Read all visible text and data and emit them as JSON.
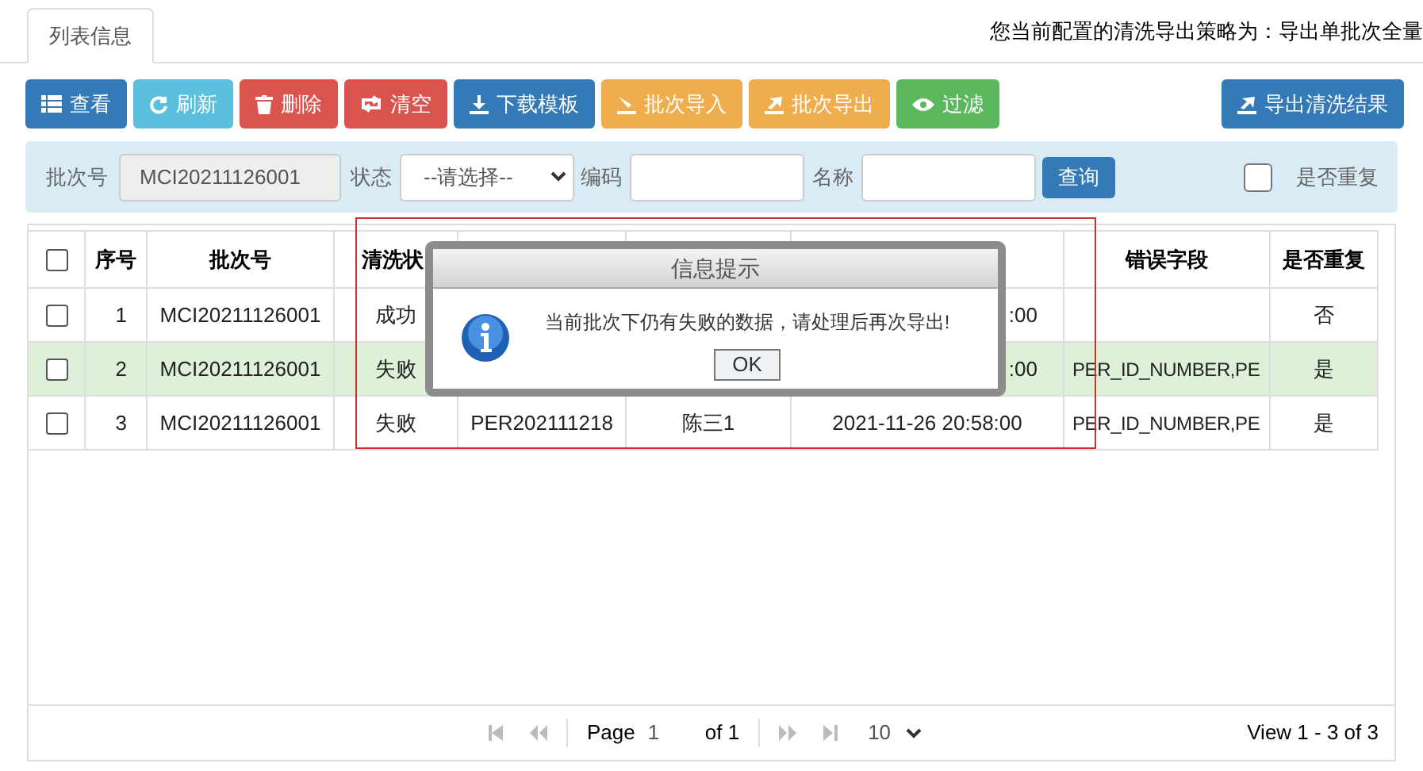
{
  "tabs": [
    {
      "label": "列表信息",
      "selected": true
    }
  ],
  "policy_text": "您当前配置的清洗导出策略为：导出单批次全量",
  "toolbar": [
    {
      "label": "查看",
      "color": "#337ab7"
    },
    {
      "label": "刷新",
      "color": "#5bc0de"
    },
    {
      "label": "删除",
      "color": "#d9534f"
    },
    {
      "label": "清空",
      "color": "#d9534f"
    },
    {
      "label": "下载模板",
      "color": "#337ab7"
    },
    {
      "label": "批次导入",
      "color": "#f0ad4e"
    },
    {
      "label": "批次导出",
      "color": "#f0ad4e"
    },
    {
      "label": "过滤",
      "color": "#5cb85c"
    }
  ],
  "export_button": {
    "label": "导出清洗结果"
  },
  "search": {
    "batch_label": "批次号",
    "batch_value": "MCI20211126001",
    "status_label": "状态",
    "status_placeholder": "--请选择--",
    "code_label": "编码",
    "name_label": "名称",
    "query_button": "查询",
    "duplicate_label": "是否重复",
    "duplicate_checked": false
  },
  "table": {
    "all_checked": false,
    "columns": [
      {
        "label": "序号"
      },
      {
        "label": "批次号"
      },
      {
        "label": "清洗状"
      },
      {},
      {},
      {},
      {
        "label": "错误字段"
      },
      {
        "label": "是否重复"
      }
    ],
    "rows": [
      {
        "checked": false,
        "selected": false,
        "cells": [
          "1",
          "MCI20211126001",
          "成功",
          null,
          null,
          ":00",
          null,
          "否"
        ]
      },
      {
        "checked": false,
        "selected": true,
        "cells": [
          "2",
          "MCI20211126001",
          "失败",
          null,
          null,
          ":00",
          "PER_ID_NUMBER,PE",
          "是"
        ]
      },
      {
        "checked": false,
        "selected": false,
        "cells": [
          "3",
          "MCI20211126001",
          "失败",
          "PER202111218",
          "陈三1",
          "2021-11-26 20:58:00",
          "PER_ID_NUMBER,PE",
          "是"
        ]
      }
    ]
  },
  "dialog": {
    "title": "信息提示",
    "message": "当前批次下仍有失败的数据，请处理后再次导出!",
    "button": "OK"
  },
  "pager": {
    "page_label": "Page",
    "page_value": "1",
    "of_label": "of 1",
    "page_size": "10",
    "view": "View 1 - 3 of 3"
  }
}
